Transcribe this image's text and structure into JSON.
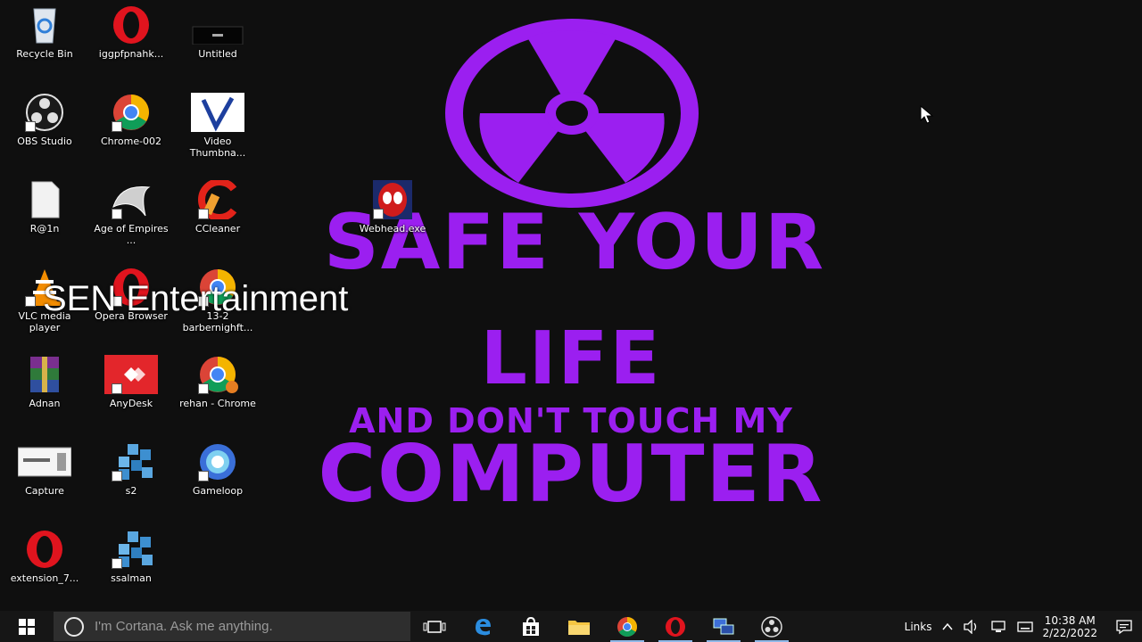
{
  "wallpaper": {
    "line1": "SAFE YOUR",
    "line2": "LIFE",
    "line3": "AND DON'T TOUCH MY",
    "line4": "COMPUTER",
    "color": "#9b1ff0"
  },
  "watermark": "SEN Entertainment",
  "desktop_icons": [
    {
      "label": "Recycle Bin",
      "icon": "recycle-bin-icon"
    },
    {
      "label": "iggpfpnahk...",
      "icon": "opera-icon"
    },
    {
      "label": "Untitled",
      "icon": "image-file-icon"
    },
    {
      "label": "OBS Studio",
      "icon": "obs-icon"
    },
    {
      "label": "Chrome-002",
      "icon": "chrome-icon"
    },
    {
      "label": "Video Thumbna...",
      "icon": "video-thumbnail-icon"
    },
    {
      "label": "R@1n",
      "icon": "blank-file-icon"
    },
    {
      "label": "Age of Empires ...",
      "icon": "age-of-empires-icon"
    },
    {
      "label": "CCleaner",
      "icon": "ccleaner-icon"
    },
    {
      "label": "Webhead.exe",
      "icon": "spiderman-icon"
    },
    {
      "label": "VLC media player",
      "icon": "vlc-icon"
    },
    {
      "label": "Opera Browser",
      "icon": "opera-icon"
    },
    {
      "label": "13-2 barbernighft...",
      "icon": "chrome-icon"
    },
    {
      "label": "Adnan",
      "icon": "winrar-icon"
    },
    {
      "label": "AnyDesk",
      "icon": "anydesk-icon"
    },
    {
      "label": "rehan - Chrome",
      "icon": "chrome-icon"
    },
    {
      "label": "Capture",
      "icon": "capture-icon"
    },
    {
      "label": "s2",
      "icon": "dropbox-cubes-icon"
    },
    {
      "label": "Gameloop",
      "icon": "gameloop-icon"
    },
    {
      "label": "extension_7...",
      "icon": "opera-icon"
    },
    {
      "label": "ssalman",
      "icon": "dropbox-cubes-icon"
    }
  ],
  "taskbar": {
    "cortana_placeholder": "I'm Cortana. Ask me anything.",
    "pinned": [
      "task-view-icon",
      "edge-icon",
      "store-icon",
      "file-explorer-icon",
      "chrome-icon",
      "opera-icon",
      "network-app-icon",
      "obs-icon"
    ],
    "tray": {
      "links_label": "Links",
      "time": "10:38 AM",
      "date": "2/22/2022"
    }
  }
}
